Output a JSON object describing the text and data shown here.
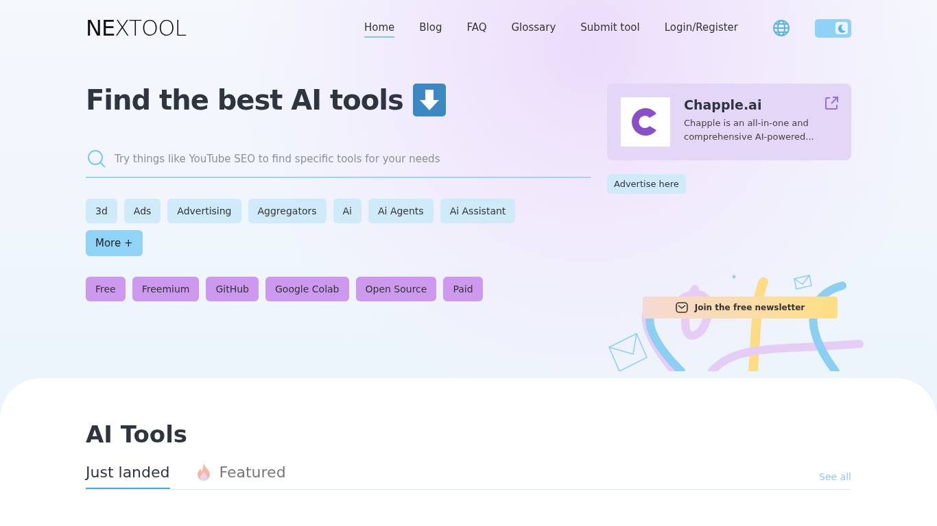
{
  "logo": "**NE**XTOOL",
  "theme_toggle": {
    "on": true
  },
  "nav": [
    {
      "label": "Home",
      "selected": true
    },
    {
      "label": "Blog",
      "selected": false
    },
    {
      "label": "FAQ",
      "selected": false
    },
    {
      "label": "Glossary",
      "selected": false
    },
    {
      "label": "Submit tool",
      "selected": false
    },
    {
      "label": "Login/Register",
      "selected": false
    }
  ],
  "hero": {
    "title": "Find the best AI tools",
    "search": {
      "placeholder": "Try things like YouTube SEO to find specific tools for your needs"
    },
    "categories": [
      "3d",
      "Ads",
      "Advertising",
      "Aggregators",
      "Ai",
      "Ai Agents",
      "Ai Assistant"
    ],
    "more": "More +",
    "pricing": [
      "Free",
      "Freemium",
      "GitHub",
      "Google Colab",
      "Open Source",
      "Paid"
    ]
  },
  "sponsor": {
    "name": "Chapple.ai",
    "description": "Chapple is an all-in-one and comprehensive AI-powered...",
    "advertise": "Advertise here"
  },
  "newsletter": "Join the free newsletter",
  "section": {
    "title": "AI Tools",
    "tabs": [
      {
        "label": "Just landed",
        "selected": true,
        "kind": "plain"
      },
      {
        "label": "Featured",
        "selected": false,
        "kind": "flame"
      }
    ],
    "see_all": "See all"
  }
}
